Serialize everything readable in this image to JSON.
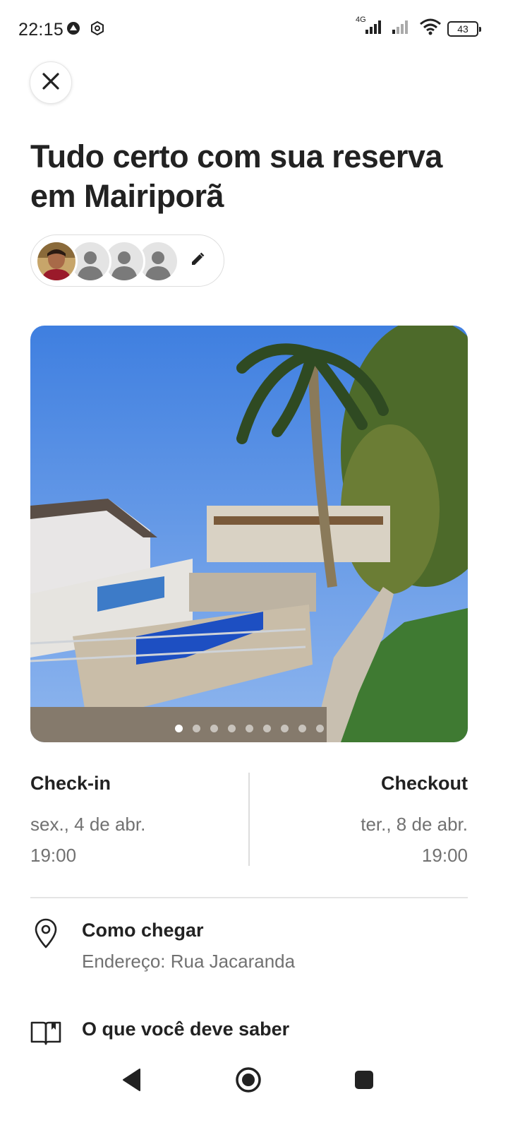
{
  "status_bar": {
    "time": "22:15",
    "network": "4G",
    "battery": "43",
    "icons": [
      "notification-icon",
      "shield-icon",
      "cell-signal-icon",
      "cell-signal-weak-icon",
      "wifi-icon",
      "battery-icon"
    ]
  },
  "header": {
    "close_icon": "close-icon",
    "title": "Tudo certo com sua reserva em Mairiporã"
  },
  "guests": {
    "count": 4,
    "edit_icon": "pencil-icon"
  },
  "photo": {
    "total_slides": 9,
    "active_slide": 1
  },
  "checkin": {
    "label": "Check-in",
    "date": "sex., 4 de abr.",
    "time": "19:00"
  },
  "checkout": {
    "label": "Checkout",
    "date": "ter., 8 de abr.",
    "time": "19:00"
  },
  "directions": {
    "icon": "location-pin-icon",
    "title": "Como chegar",
    "subtitle": "Endereço: Rua Jacaranda"
  },
  "house_rules": {
    "icon": "book-icon",
    "title": "O que você deve saber"
  },
  "nav_bar": {
    "icons": [
      "back-icon",
      "home-icon",
      "recents-icon"
    ]
  },
  "colors": {
    "text_primary": "#222222",
    "text_secondary": "#717171",
    "divider": "#dddddd"
  }
}
